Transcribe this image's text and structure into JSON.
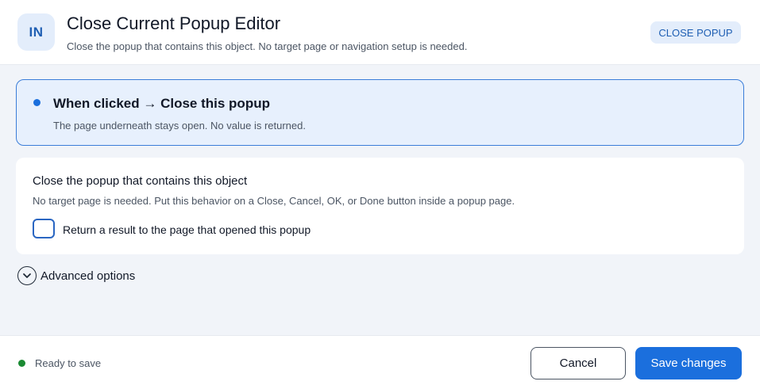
{
  "header": {
    "avatar_text": "IN",
    "title": "Close Current Popup Editor",
    "subtitle": "Close the popup that contains this object. No target page or navigation setup is needed.",
    "badge": "CLOSE POPUP"
  },
  "summary": {
    "title": "When clicked → Close this popup",
    "note": "The page underneath stays open. No value is returned."
  },
  "detail": {
    "title": "Close the popup that contains this object",
    "note": "No target page is needed. Put this behavior on a Close, Cancel, OK, or Done button inside a popup page.",
    "checkbox_label": "Return a result to the page that opened this popup",
    "checkbox_checked": false
  },
  "advanced": {
    "label": "Advanced options",
    "icon": "chevron-down-circle-icon"
  },
  "footer": {
    "status": "Ready to save",
    "status_color": "#1a8a32",
    "cancel_label": "Cancel",
    "save_label": "Save changes"
  },
  "colors": {
    "accent": "#1b6fdd",
    "accent_soft": "#e7f0fd"
  }
}
